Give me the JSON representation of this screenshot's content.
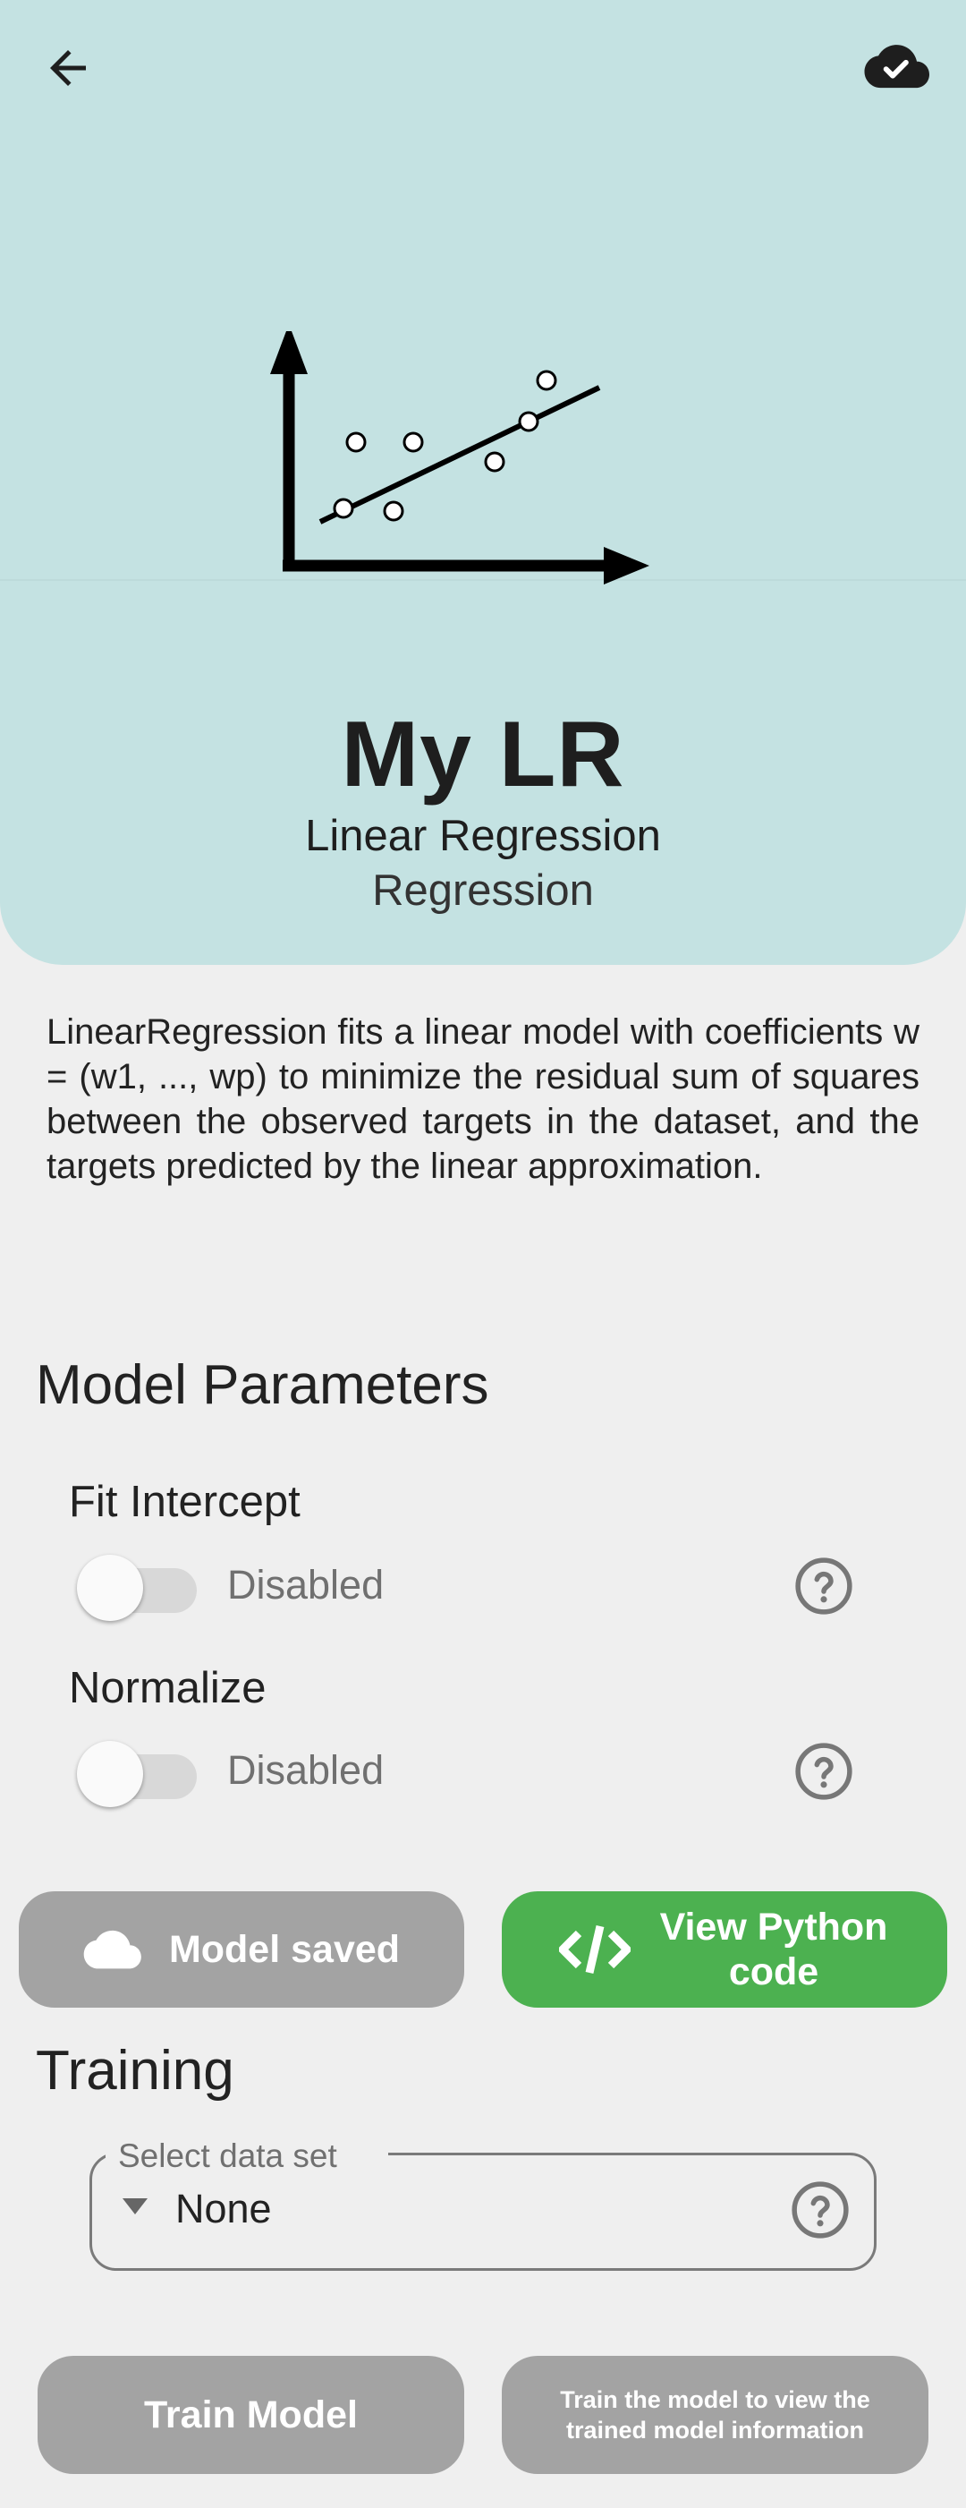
{
  "header": {
    "back_icon": "arrow-left-icon",
    "sync_icon": "cloud-check-icon"
  },
  "model": {
    "name": "My LR",
    "type": "Linear Regression",
    "category": "Regression",
    "description": "LinearRegression fits a linear model with coefficients w = (w1, ..., wp) to minimize the residual sum of squares between the observed targets in the dataset, and the targets predicted by the linear approximation."
  },
  "parameters": {
    "title": "Model Parameters",
    "items": [
      {
        "label": "Fit Intercept",
        "status": "Disabled",
        "enabled": false
      },
      {
        "label": "Normalize",
        "status": "Disabled",
        "enabled": false
      }
    ]
  },
  "actions": {
    "saved_label": "Model saved",
    "python_label": "View Python code"
  },
  "training": {
    "title": "Training",
    "dataset_label": "Select data set",
    "dataset_value": "None",
    "train_label": "Train Model",
    "info_label": "Train the model to view the trained model information"
  },
  "colors": {
    "hero_background": "#c4e2e2",
    "page_background": "#efefef",
    "accent_green": "#4cb150",
    "disabled_gray": "#a3a3a3"
  }
}
